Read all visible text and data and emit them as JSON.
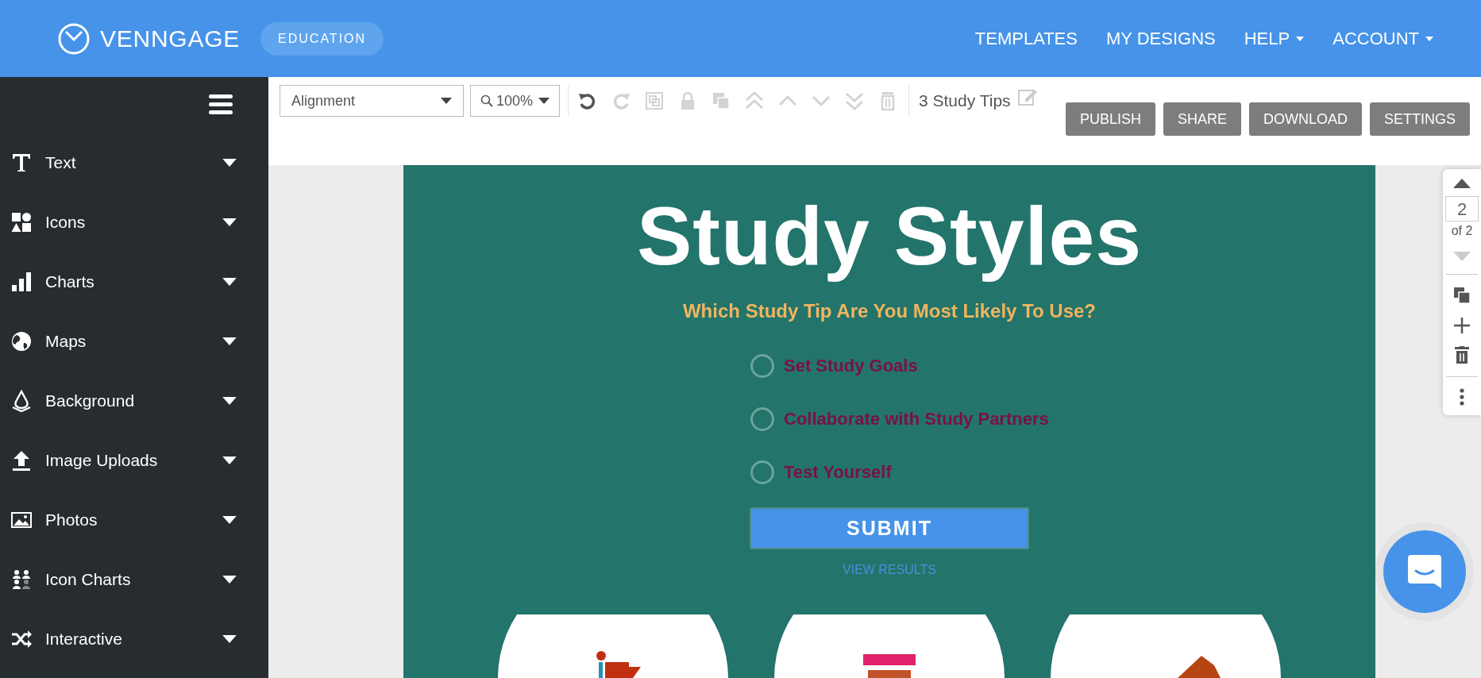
{
  "header": {
    "brand": "VENNGAGE",
    "badge": "EDUCATION",
    "nav": [
      {
        "label": "TEMPLATES",
        "has_menu": false
      },
      {
        "label": "MY DESIGNS",
        "has_menu": false
      },
      {
        "label": "HELP",
        "has_menu": true
      },
      {
        "label": "ACCOUNT",
        "has_menu": true
      }
    ]
  },
  "sidebar": {
    "items": [
      {
        "label": "Text",
        "kind": "text"
      },
      {
        "label": "Icons",
        "kind": "icons"
      },
      {
        "label": "Charts",
        "kind": "charts"
      },
      {
        "label": "Maps",
        "kind": "maps"
      },
      {
        "label": "Background",
        "kind": "background"
      },
      {
        "label": "Image Uploads",
        "kind": "uploads"
      },
      {
        "label": "Photos",
        "kind": "photos"
      },
      {
        "label": "Icon Charts",
        "kind": "iconcharts"
      },
      {
        "label": "Interactive",
        "kind": "interactive"
      }
    ]
  },
  "toolbar": {
    "alignment": "Alignment",
    "zoom": "100%",
    "tools": [
      {
        "kind": "undo",
        "disabled": false
      },
      {
        "kind": "redo",
        "disabled": true
      },
      {
        "kind": "group",
        "disabled": true
      },
      {
        "kind": "lock",
        "disabled": true
      },
      {
        "kind": "copy",
        "disabled": true
      },
      {
        "kind": "front",
        "disabled": true
      },
      {
        "kind": "forward",
        "disabled": true
      },
      {
        "kind": "backward",
        "disabled": true
      },
      {
        "kind": "back",
        "disabled": true
      },
      {
        "kind": "delete",
        "disabled": true
      }
    ],
    "doc_title": "3 Study Tips",
    "actions": [
      "PUBLISH",
      "SHARE",
      "DOWNLOAD",
      "SETTINGS"
    ]
  },
  "canvas": {
    "title": "Study Styles",
    "question": "Which Study Tip Are You Most Likely To Use?",
    "options": [
      {
        "label": "Set Study Goals",
        "selected": false
      },
      {
        "label": "Collaborate with Study Partners",
        "selected": false
      },
      {
        "label": "Test Yourself",
        "selected": false
      }
    ],
    "submit": "SUBMIT",
    "results_link": "VIEW RESULTS"
  },
  "page_nav": {
    "page": "2",
    "total": "of 2",
    "up_disabled": false,
    "down_disabled": true
  }
}
